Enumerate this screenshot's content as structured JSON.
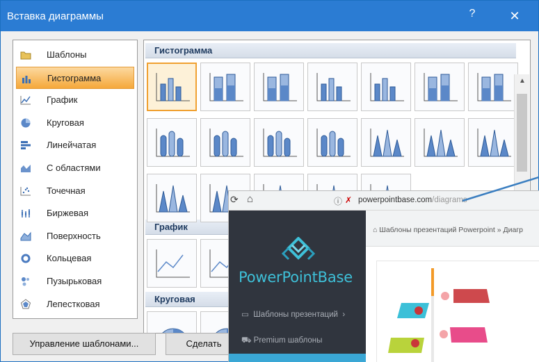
{
  "dialog": {
    "title": "Вставка диаграммы",
    "help_glyph": "?",
    "close_glyph": "✕",
    "categories": [
      {
        "label": "Шаблоны",
        "icon": "folder-icon"
      },
      {
        "label": "Гистограмма",
        "icon": "column-chart-icon",
        "selected": true
      },
      {
        "label": "График",
        "icon": "line-chart-icon"
      },
      {
        "label": "Круговая",
        "icon": "pie-chart-icon"
      },
      {
        "label": "Линейчатая",
        "icon": "bar-chart-icon"
      },
      {
        "label": "С областями",
        "icon": "area-chart-icon"
      },
      {
        "label": "Точечная",
        "icon": "scatter-chart-icon"
      },
      {
        "label": "Биржевая",
        "icon": "stock-chart-icon"
      },
      {
        "label": "Поверхность",
        "icon": "surface-chart-icon"
      },
      {
        "label": "Кольцевая",
        "icon": "doughnut-chart-icon"
      },
      {
        "label": "Пузырьковая",
        "icon": "bubble-chart-icon"
      },
      {
        "label": "Лепестковая",
        "icon": "radar-chart-icon"
      }
    ],
    "sections": {
      "histogram": "Гистограмма",
      "line": "График",
      "pie": "Круговая"
    },
    "buttons": {
      "manage": "Управление шаблонами...",
      "make": "Сделать"
    },
    "colors": {
      "accent": "#2b7cd3",
      "selection": "#f5a83a"
    }
  },
  "browser": {
    "url_main": "powerpointbase.com",
    "url_path": "/diagrams",
    "brand": "PowerPointBase",
    "nav": [
      "Шаблоны презентаций",
      "Premium шаблоны"
    ],
    "breadcrumb": "Шаблоны презентаций Powerpoint » Диагр"
  }
}
